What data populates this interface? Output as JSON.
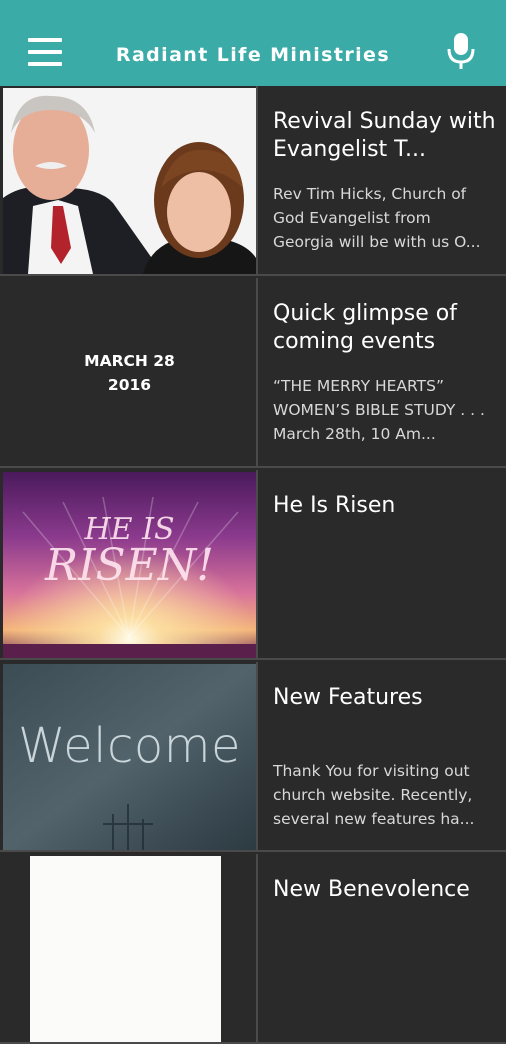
{
  "app_bar": {
    "title": "Radiant Life Ministries",
    "menu_icon": "hamburger-menu-icon",
    "mic_icon": "microphone-icon",
    "color": "#3aaba7"
  },
  "feed": [
    {
      "title": "Revival Sunday with Evangelist T...",
      "description": "Rev Tim Hicks, Church of God Evangelist from Georgia will be with us O...",
      "thumb": "photo"
    },
    {
      "title": "Quick glimpse of coming events",
      "description": "“THE MERRY HEARTS” WOMEN’S BIBLE STUDY . . . March 28th, 10 Am...",
      "thumb_date_line1": "MARCH 28",
      "thumb_date_line2": "2016"
    },
    {
      "title": "He Is Risen",
      "description": "",
      "thumb_text_line1": "HE IS",
      "thumb_text_line2": "RISEN!"
    },
    {
      "title": "New Features",
      "description": "Thank You for visiting out church website.  Recently, several new features ha...",
      "thumb_text": "Welcome"
    },
    {
      "title": "New Benevolence",
      "description": ""
    }
  ]
}
